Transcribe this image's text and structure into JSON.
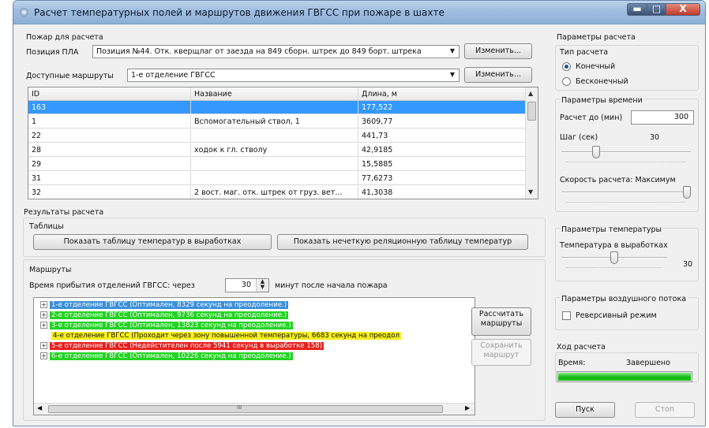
{
  "window": {
    "title": "Расчет температурных полей и маршрутов движения ГВГСС при пожаре в шахте",
    "minimize_glyph": "▬",
    "maximize_glyph": "□",
    "close_glyph": "X"
  },
  "fire": {
    "group_label": "Пожар для расчета",
    "position_label": "Позиция ПЛА",
    "position_value": "Позиция №44. Отк. кверщлаг от заезда на 849 сборн. штрек до 849 борт. штрека",
    "position_change": "Изменить...",
    "routes_label": "Доступные маршруты",
    "routes_value": "1-е отделение ГВГСС",
    "routes_change": "Изменить..."
  },
  "table": {
    "columns": [
      "ID",
      "Название",
      "Длина, м"
    ],
    "rows": [
      {
        "id": "163",
        "name": "",
        "length": "177,522"
      },
      {
        "id": "1",
        "name": "Вспомогательный ствол, 1",
        "length": "3609,77"
      },
      {
        "id": "22",
        "name": "",
        "length": "441,73"
      },
      {
        "id": "28",
        "name": "ходок к гл. стволу",
        "length": "42,9185"
      },
      {
        "id": "29",
        "name": "",
        "length": "15,5885"
      },
      {
        "id": "31",
        "name": "",
        "length": "77,6273"
      },
      {
        "id": "32",
        "name": "2 вост. маг. отк. штрек от груз. вет...",
        "length": "41,3038"
      }
    ],
    "selected_index": 0
  },
  "results": {
    "group_label": "Результаты расчета",
    "tables_label": "Таблицы",
    "show_temp_table": "Показать таблицу температур в выработках",
    "show_fuzzy_table": "Показать нечеткую реляционную таблицу температур",
    "routes_label": "Маршруты",
    "arrival_prefix": "Время прибытия отделений ГВГСС: через",
    "arrival_value": "30",
    "arrival_suffix": "минут после начала пожара",
    "calc_routes_line1": "Рассчитать",
    "calc_routes_line2": "маршруты",
    "save_route_line1": "Сохранить",
    "save_route_line2": "маршрут",
    "scroll_glyph": "III",
    "routes": [
      {
        "expander": "+",
        "text": "1-е отделение ГВГСС (Оптимален, 8329 секунд на преодоление.)",
        "bg": "#3b8fd9",
        "color": "#ffffff"
      },
      {
        "expander": "+",
        "text": "2-е отделение ГВГСС (Оптимален, 9736 секунд на преодоление.)",
        "bg": "#22d322",
        "color": "#ffffff"
      },
      {
        "expander": "+",
        "text": "3-е отделение ГВГСС (Оптимален, 13823 секунд на преодоление.)",
        "bg": "#22d322",
        "color": "#ffffff"
      },
      {
        "expander": "",
        "text": "4-е отделение ГВГСС (Проходит через зону повышенной температуры, 6683 секунд на преодол",
        "bg": "#f6ee1c",
        "color": "#111111"
      },
      {
        "expander": "+",
        "text": "5-е отделение ГВГСС (Недейстителен после 5941 секунд в выработке 158)",
        "bg": "#e8201d",
        "color": "#ffffff"
      },
      {
        "expander": "+",
        "text": "6-е отделение ГВГСС (Оптимален, 10226 секунд на преодоление.)",
        "bg": "#22d322",
        "color": "#ffffff"
      }
    ]
  },
  "params": {
    "group_label": "Параметры расчета",
    "type_label": "Тип расчета",
    "type_finite": "Конечный",
    "type_infinite": "Бесконечный",
    "type_selected": "Конечный",
    "time_label": "Параметры времени",
    "calc_until_label": "Расчет до (мин)",
    "calc_until_value": "300",
    "step_label": "Шаг (сек)",
    "step_value": "30",
    "step_slider_level": 0.25,
    "speed_label": "Скорость расчета: Максимум",
    "speed_slider_level": 1.0,
    "temp_group_label": "Параметры температуры",
    "temp_label": "Температура в выработках",
    "temp_value": "30",
    "temp_slider_level": 0.5,
    "air_group_label": "Параметры воздушного потока",
    "reverse_label": "Реверсивный режим",
    "reverse_checked": false
  },
  "progress": {
    "group_label": "Ход расчета",
    "time_label": "Время:",
    "status": "Завершено",
    "level": 1.0,
    "start": "Пуск",
    "stop": "Стоп"
  }
}
